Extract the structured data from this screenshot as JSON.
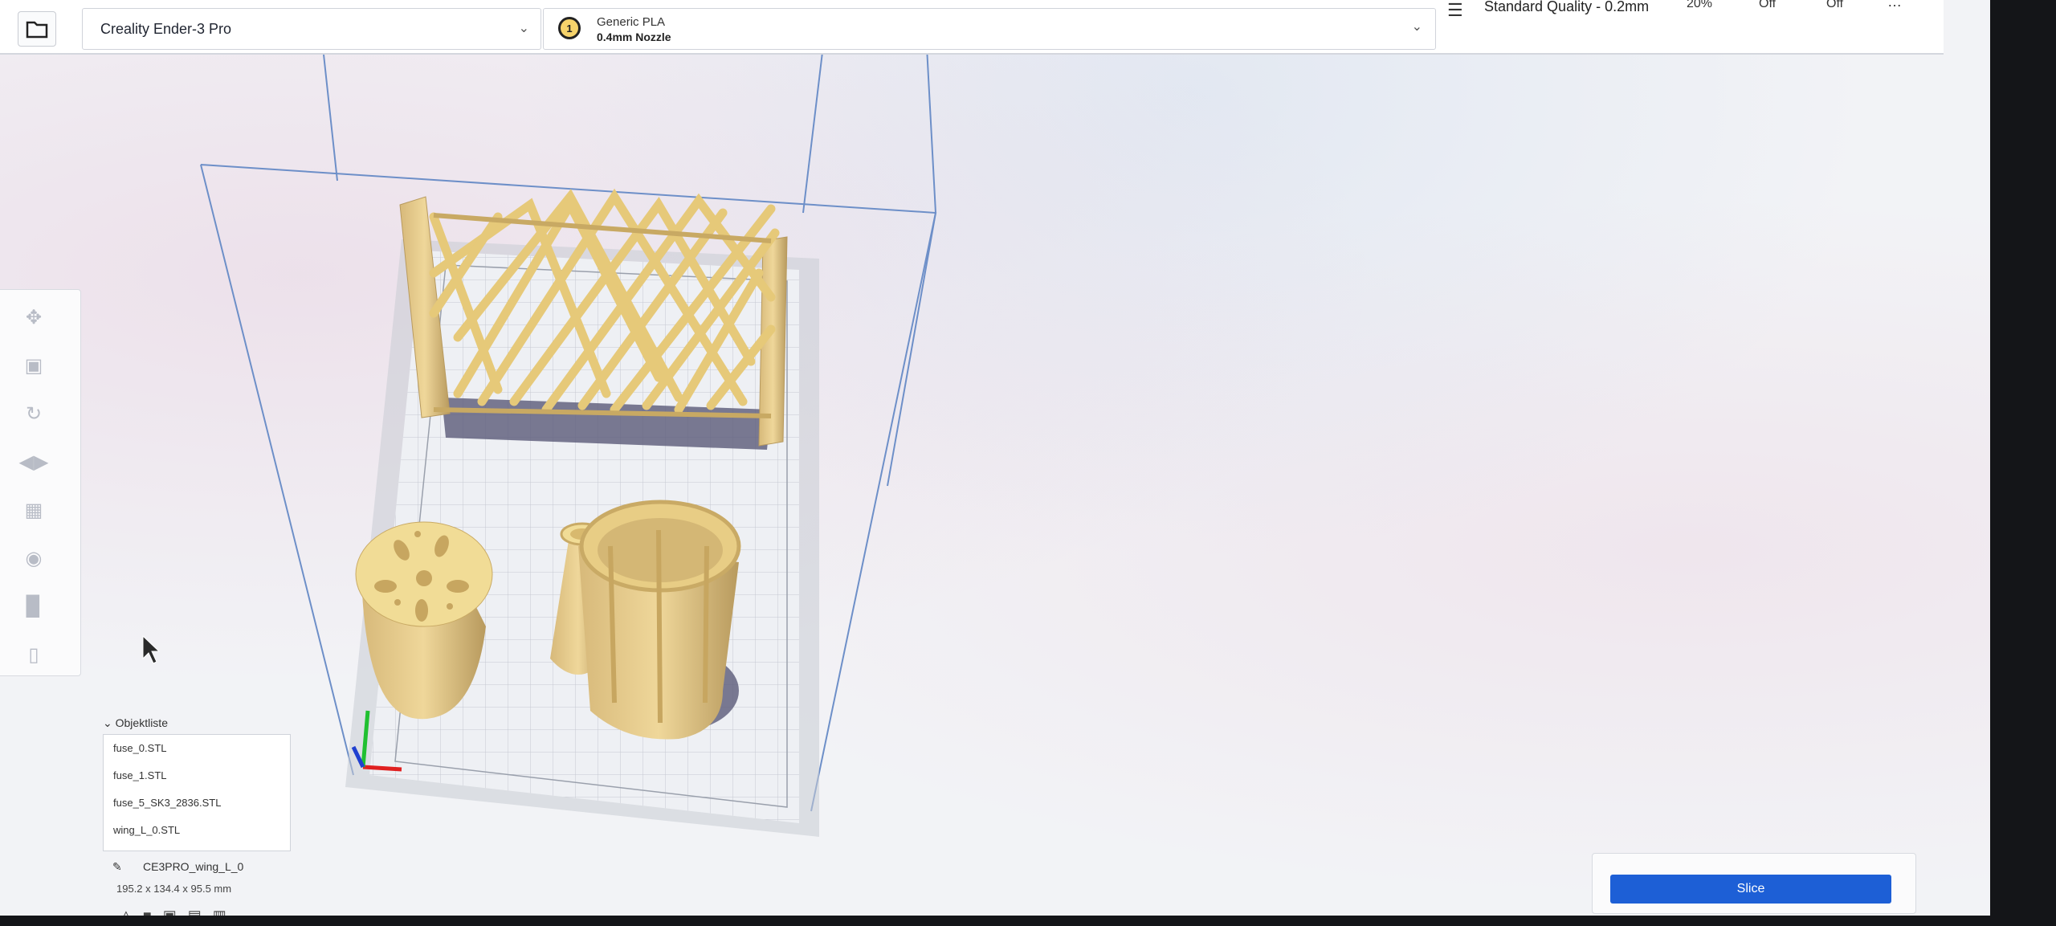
{
  "topbar": {
    "printer": "Creality Ender-3 Pro",
    "material_name": "Generic PLA",
    "nozzle": "0.4mm Nozzle",
    "material_icon_text": "1",
    "quality": "Standard Quality - 0.2mm",
    "infill": "20%",
    "support": "Off",
    "adhesion": "Off",
    "more": "…"
  },
  "icons": {
    "open": "folder-icon",
    "move": "move-icon",
    "scale": "scale-icon",
    "rotate": "rotate-icon",
    "mirror": "mirror-icon",
    "per_model": "per-model-settings-icon",
    "support_blocker": "support-blocker-icon",
    "extra": "extra-tool-icon",
    "delete": "delete-icon"
  },
  "object_list": {
    "header": "Objektliste",
    "items": [
      "fuse_0.STL",
      "fuse_1.STL",
      "fuse_5_SK3_2836.STL",
      "wing_L_0.STL"
    ],
    "selected_name": "CE3PRO_wing_L_0",
    "dimensions": "195.2 x 134.4 x 95.5 mm"
  },
  "slice": {
    "label": "Slice"
  },
  "colors": {
    "accent": "#1d5fd6",
    "model": "#e9cf86",
    "shadow": "#5a5a78"
  }
}
